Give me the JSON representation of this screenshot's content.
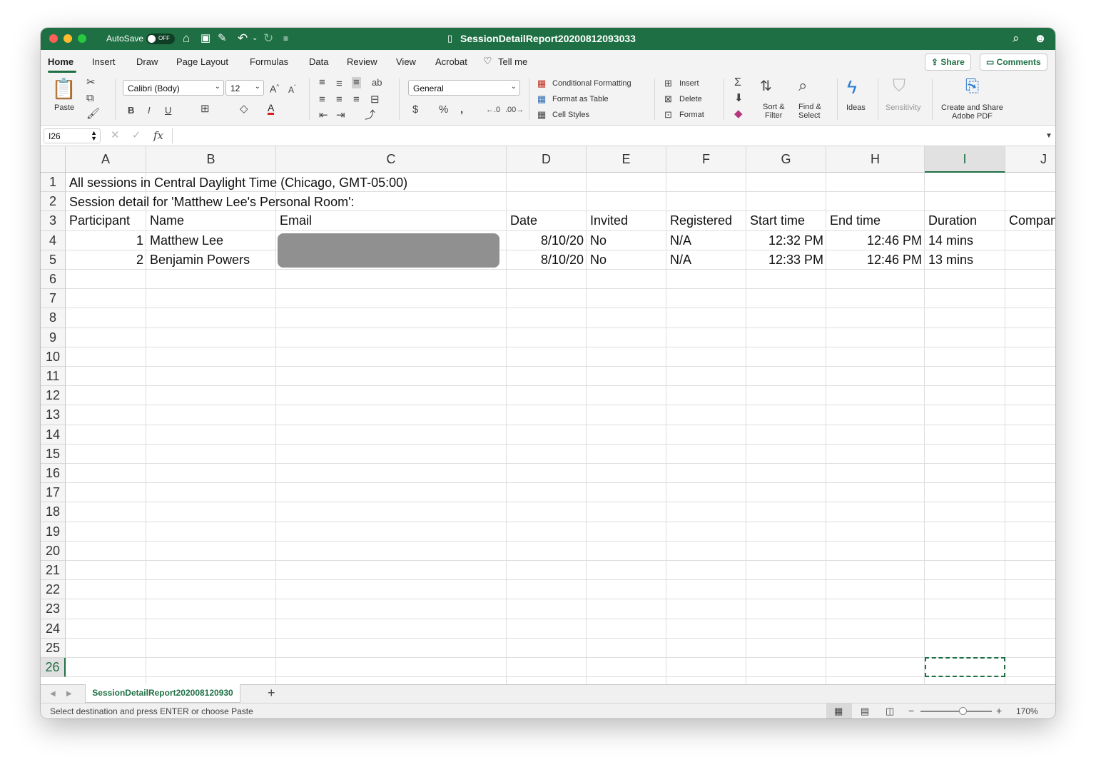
{
  "titlebar": {
    "autosave_label": "AutoSave",
    "autosave_state": "OFF",
    "doc_title": "SessionDetailReport20200812093033"
  },
  "menu": {
    "tabs": [
      "Home",
      "Insert",
      "Draw",
      "Page Layout",
      "Formulas",
      "Data",
      "Review",
      "View",
      "Acrobat"
    ],
    "tell_me": "Tell me",
    "share": "Share",
    "comments": "Comments"
  },
  "ribbon": {
    "paste": "Paste",
    "font_name": "Calibri (Body)",
    "font_size": "12",
    "number_format": "General",
    "conditional_formatting": "Conditional Formatting",
    "format_as_table": "Format as Table",
    "cell_styles": "Cell Styles",
    "insert": "Insert",
    "delete": "Delete",
    "format": "Format",
    "sort_filter_1": "Sort &",
    "sort_filter_2": "Filter",
    "find_select_1": "Find &",
    "find_select_2": "Select",
    "ideas": "Ideas",
    "sensitivity": "Sensitivity",
    "adobe_1": "Create and Share",
    "adobe_2": "Adobe PDF"
  },
  "formula_bar": {
    "name_box": "I26",
    "fx": "fx",
    "value": ""
  },
  "columns": [
    "A",
    "B",
    "C",
    "D",
    "E",
    "F",
    "G",
    "H",
    "I",
    "J"
  ],
  "rows": [
    "1",
    "2",
    "3",
    "4",
    "5",
    "6",
    "7",
    "8",
    "9",
    "10",
    "11",
    "12",
    "13",
    "14",
    "15",
    "16",
    "17",
    "18",
    "19",
    "20",
    "21",
    "22",
    "23",
    "24",
    "25",
    "26"
  ],
  "cells": {
    "r1": "All sessions in Central Daylight Time (Chicago, GMT-05:00)",
    "r2": "Session detail for 'Matthew Lee's Personal Room':",
    "headers": [
      "Participant",
      "Name",
      "Email",
      "Date",
      "Invited",
      "Registered",
      "Start time",
      "End time",
      "Duration",
      "Compan"
    ],
    "data": [
      [
        "1",
        "Matthew Lee",
        "",
        "8/10/20",
        "No",
        "N/A",
        "12:32 PM",
        "12:46 PM",
        "14 mins",
        ""
      ],
      [
        "2",
        "Benjamin Powers",
        "",
        "8/10/20",
        "No",
        "N/A",
        "12:33 PM",
        "12:46 PM",
        "13 mins",
        ""
      ]
    ]
  },
  "sheet": {
    "tab_name": "SessionDetailReport202008120930",
    "add": "+"
  },
  "status": {
    "message": "Select destination and press ENTER or choose Paste",
    "zoom": "170%"
  },
  "colors": {
    "accent": "#1e7044",
    "redaction": "#909090"
  }
}
